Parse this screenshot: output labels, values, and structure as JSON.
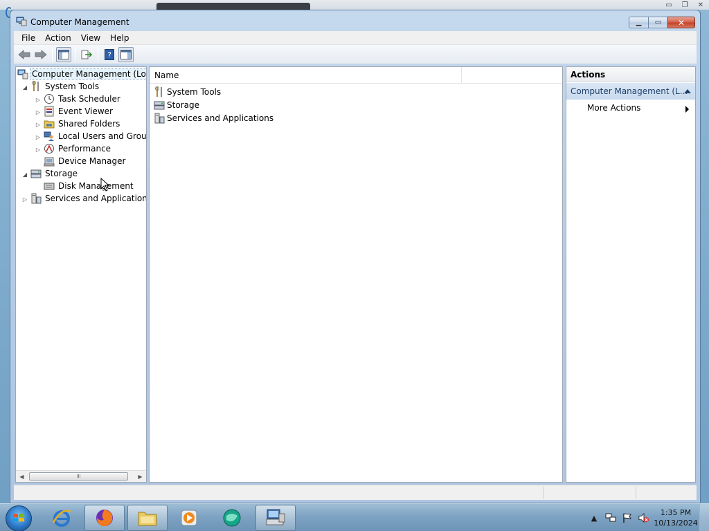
{
  "window": {
    "title": "Computer Management"
  },
  "menu": [
    "File",
    "Action",
    "View",
    "Help"
  ],
  "tree": {
    "items": [
      {
        "label": "Computer Management (Local",
        "icon": "computer-management-icon"
      },
      {
        "label": "System Tools",
        "icon": "tools-icon"
      },
      {
        "label": "Task Scheduler",
        "icon": "clock-icon"
      },
      {
        "label": "Event Viewer",
        "icon": "event-viewer-icon"
      },
      {
        "label": "Shared Folders",
        "icon": "shared-folder-icon"
      },
      {
        "label": "Local Users and Groups",
        "icon": "users-icon"
      },
      {
        "label": "Performance",
        "icon": "performance-icon"
      },
      {
        "label": "Device Manager",
        "icon": "device-manager-icon"
      },
      {
        "label": "Storage",
        "icon": "storage-icon"
      },
      {
        "label": "Disk Management",
        "icon": "disk-icon"
      },
      {
        "label": "Services and Applications",
        "icon": "services-icon"
      }
    ],
    "scroll_thumb_glyph": "III"
  },
  "content": {
    "column_name": "Name",
    "rows": [
      {
        "label": "System Tools",
        "icon": "tools-icon"
      },
      {
        "label": "Storage",
        "icon": "storage-icon"
      },
      {
        "label": "Services and Applications",
        "icon": "services-icon"
      }
    ]
  },
  "actions": {
    "header": "Actions",
    "section": "Computer Management (L...",
    "items": [
      "More Actions"
    ]
  },
  "taskbar": {
    "clock_time": "1:35 PM",
    "clock_date": "10/13/2024"
  },
  "colors": {
    "selection": "#e5f3fb",
    "actions_section": "#c8daee",
    "close_button": "#c4432b"
  }
}
